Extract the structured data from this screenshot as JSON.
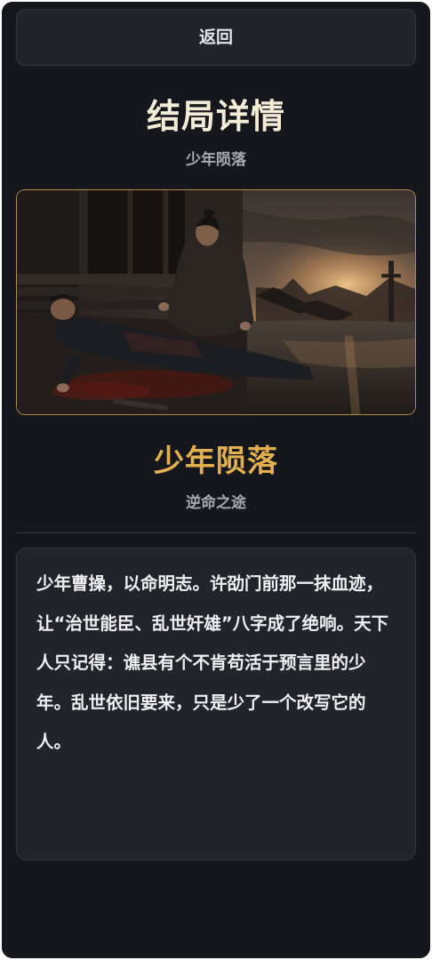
{
  "nav": {
    "back_label": "返回"
  },
  "header": {
    "title": "结局详情",
    "subtitle": "少年陨落"
  },
  "ending": {
    "name": "少年陨落",
    "route": "逆命之途",
    "image_icon": "ending-illustration",
    "accent_color": "#e3b04f",
    "border_color": "#b08a45"
  },
  "story": {
    "text": "少年曹操，以命明志。许劭门前那一抹血迹，让“治世能臣、乱世奸雄”八字成了绝响。天下人只记得：谯县有个不肯苟活于预言里的少年。乱世依旧要来，只是少了一个改写它的人。"
  }
}
